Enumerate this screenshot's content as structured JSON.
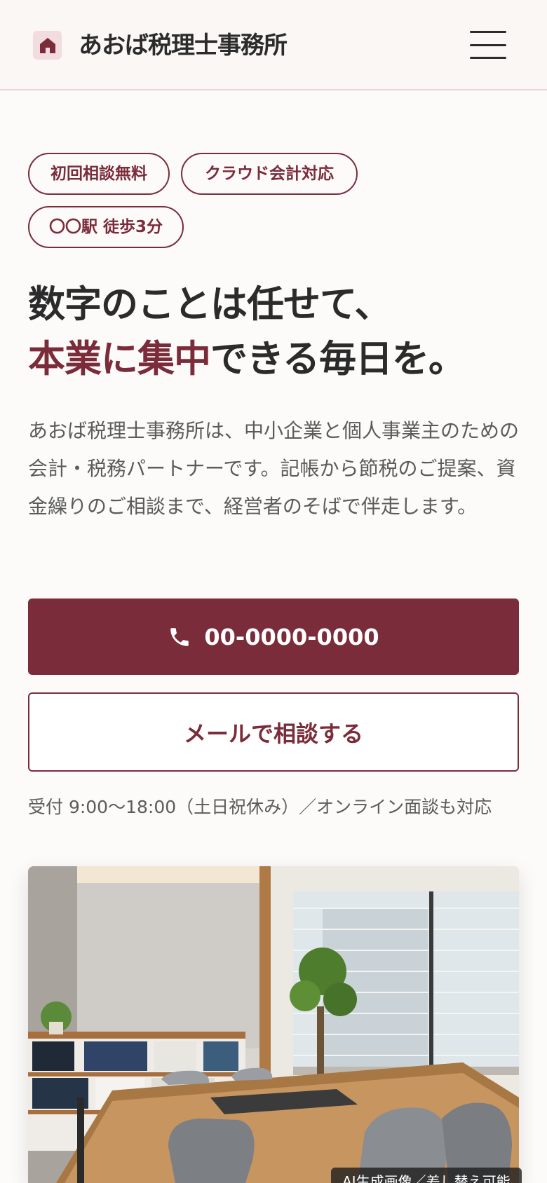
{
  "header": {
    "brand": "あおば税理士事務所",
    "logo_icon": "house-icon",
    "menu_icon": "hamburger-menu-icon"
  },
  "tags": [
    "初回相談無料",
    "クラウド会計対応",
    "〇〇駅 徒歩3分"
  ],
  "hero": {
    "headline_line1": "数字のことは任せて、",
    "headline_accent": "本業に集中",
    "headline_rest": "できる毎日を。",
    "lead": "あおば税理士事務所は、中小企業と個人事業主のための会計・税務パートナーです。記帳から節税のご提案、資金繰りのご相談まで、経営者のそばで伴走します。"
  },
  "cta": {
    "phone_icon": "phone-icon",
    "phone": "00-0000-0000",
    "mail_label": "メールで相談する"
  },
  "hours": "受付 9:00〜18:00（土日祝休み）／オンライン面談も対応",
  "photo": {
    "caption": "AI生成画像／差し替え可能"
  },
  "colors": {
    "accent": "#7b2c3a",
    "background": "#fcfbfa",
    "header_bg": "#faf7f5",
    "text": "#2b2b2b"
  }
}
